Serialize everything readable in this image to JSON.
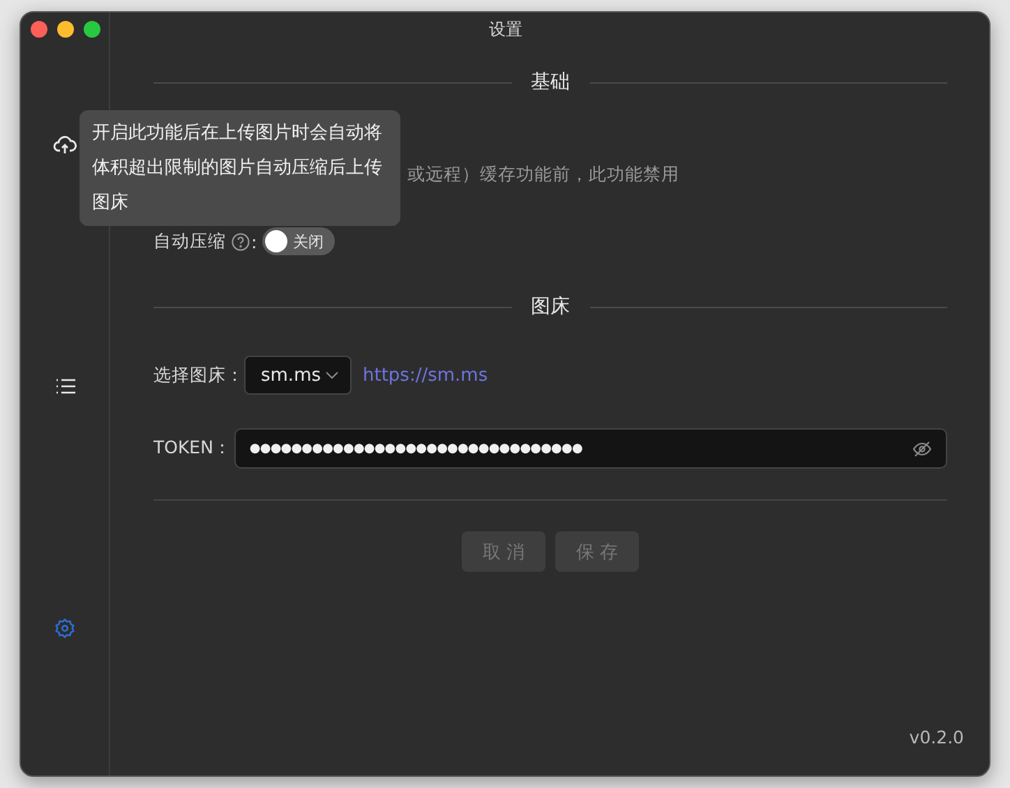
{
  "window": {
    "title": "设置"
  },
  "sidebar": {
    "items": [
      {
        "kind": "upload",
        "selected": false
      },
      {
        "kind": "list",
        "selected": false
      },
      {
        "kind": "settings",
        "selected": true
      }
    ]
  },
  "sections": [
    {
      "title": "基础"
    },
    {
      "title": "图床"
    }
  ],
  "basic": {
    "hint": "或远程）缓存功能前，此功能禁用",
    "compress": {
      "label": "自动压缩",
      "colon": ":",
      "on": false,
      "state_text": "关闭"
    },
    "tooltip": "开启此功能后在上传图片时会自动将体积超出限制的图片自动压缩后上传图床"
  },
  "host": {
    "label": "选择图床：",
    "value": "sm.ms",
    "link": "https://sm.ms"
  },
  "token": {
    "label": "TOKEN：",
    "value": "●●●●●●●●●●●●●●●●●●●●●●●●●●●●●●●●"
  },
  "buttons": [
    {
      "label": "取 消",
      "disabled": true
    },
    {
      "label": "保 存",
      "disabled": true
    }
  ],
  "version": "v0.2.0"
}
